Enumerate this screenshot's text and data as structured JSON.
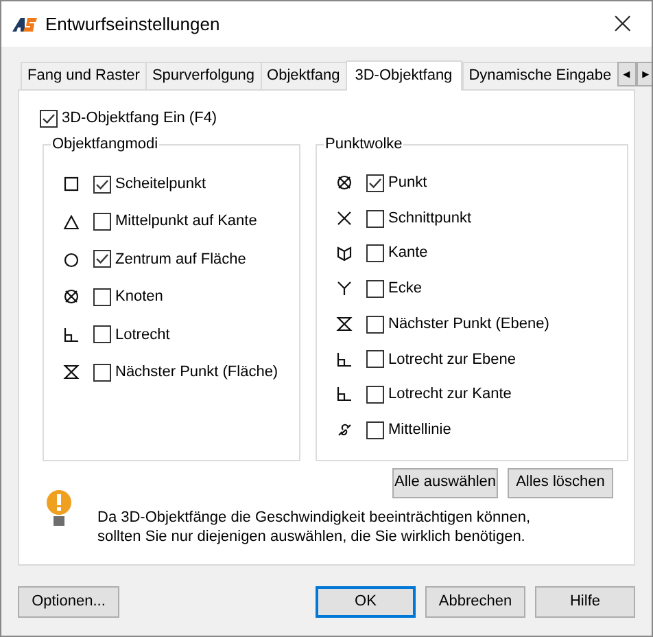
{
  "window": {
    "title": "Entwurfseinstellungen",
    "close": "×"
  },
  "tabs": [
    {
      "label": "Fang und Raster",
      "selected": false
    },
    {
      "label": "Spurverfolgung",
      "selected": false
    },
    {
      "label": "Objektfang",
      "selected": false
    },
    {
      "label": "3D-Objektfang",
      "selected": true
    },
    {
      "label": "Dynamische Eingabe",
      "selected": false
    }
  ],
  "tab_scroll": [
    "◂",
    "▸"
  ],
  "master": {
    "label": "3D-Objektfang Ein (F4)",
    "checked": true
  },
  "groups": [
    {
      "title": "Objektfangmodi",
      "items": [
        {
          "label": "Scheitelpunkt",
          "checked": true
        },
        {
          "label": "Mittelpunkt auf Kante",
          "checked": false
        },
        {
          "label": "Zentrum auf Fläche",
          "checked": true
        },
        {
          "label": "Knoten",
          "checked": false
        },
        {
          "label": "Lotrecht",
          "checked": false
        },
        {
          "label": "Nächster Punkt (Fläche)",
          "checked": false
        }
      ]
    },
    {
      "title": "Punktwolke",
      "items": [
        {
          "label": "Punkt",
          "checked": true
        },
        {
          "label": "Schnittpunkt",
          "checked": false
        },
        {
          "label": "Kante",
          "checked": false
        },
        {
          "label": "Ecke",
          "checked": false
        },
        {
          "label": "Nächster Punkt (Ebene)",
          "checked": false
        },
        {
          "label": "Lotrecht zur Ebene",
          "checked": false
        },
        {
          "label": "Lotrecht zur Kante",
          "checked": false
        },
        {
          "label": "Mittellinie",
          "checked": false
        }
      ]
    }
  ],
  "select_buttons": [
    "Alle auswählen",
    "Alles löschen"
  ],
  "note": "Da 3D-Objektfänge die Geschwindigkeit beeinträchtigen können, sollten Sie nur diejenigen auswählen, die Sie wirklich benötigen.",
  "footer": {
    "options": "Optionen...",
    "buttons": [
      {
        "label": "OK",
        "selected": true
      },
      {
        "label": "Abbrechen",
        "selected": false
      },
      {
        "label": "Hilfe",
        "selected": false
      }
    ]
  }
}
